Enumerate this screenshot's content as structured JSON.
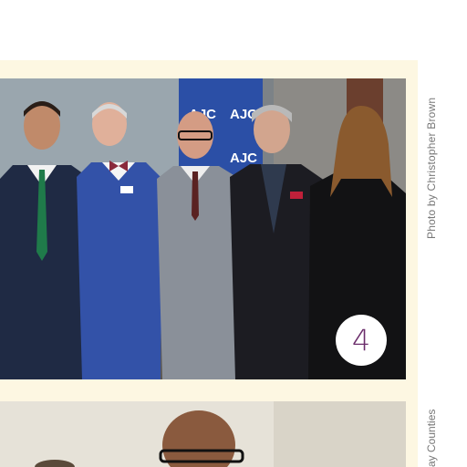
{
  "photo_top": {
    "banner_logos": [
      "AJC",
      "AJC",
      "AJC"
    ],
    "caption_number": "4"
  },
  "credits": {
    "photo_credit": "Photo by Christopher Brown",
    "side_text": "ay Counties"
  },
  "colors": {
    "cream": "#fdf7e2",
    "badge_number": "#6b2d6b",
    "banner": "#2b4fa6"
  }
}
